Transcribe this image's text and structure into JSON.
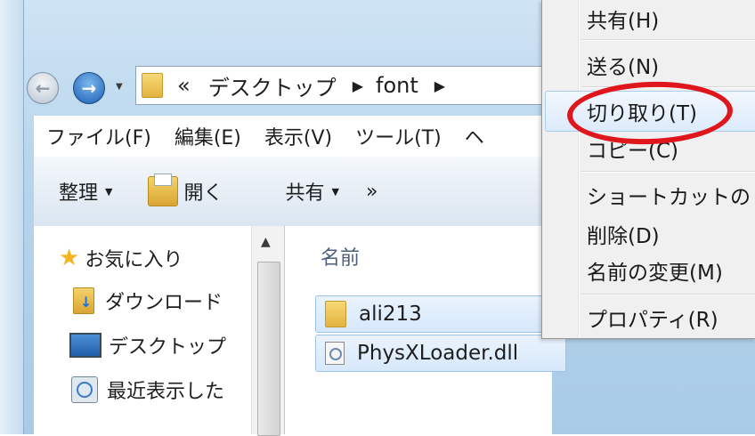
{
  "address_bar": {
    "overflow": "«",
    "crumbs": [
      "デスクトップ",
      "font"
    ]
  },
  "menubar": {
    "items": [
      "ファイル(F)",
      "編集(E)",
      "表示(V)",
      "ツール(T)",
      "ヘ"
    ]
  },
  "toolbar": {
    "organize": "整理",
    "open": "開く",
    "share": "共有",
    "more": "»"
  },
  "nav_pane": {
    "items": [
      "お気に入り",
      "ダウンロード",
      "デスクトップ",
      "最近表示した"
    ]
  },
  "file_list": {
    "column_name": "名前",
    "files": [
      "ali213",
      "PhysXLoader.dll"
    ]
  },
  "context_menu": {
    "items": [
      "共有(H)",
      "送る(N)",
      "切り取り(T)",
      "コピー(C)",
      "ショートカットの",
      "削除(D)",
      "名前の変更(M)",
      "プロパティ(R)"
    ]
  },
  "colors": {
    "annotation": "#e0161d",
    "highlight": "#dcebfc"
  }
}
